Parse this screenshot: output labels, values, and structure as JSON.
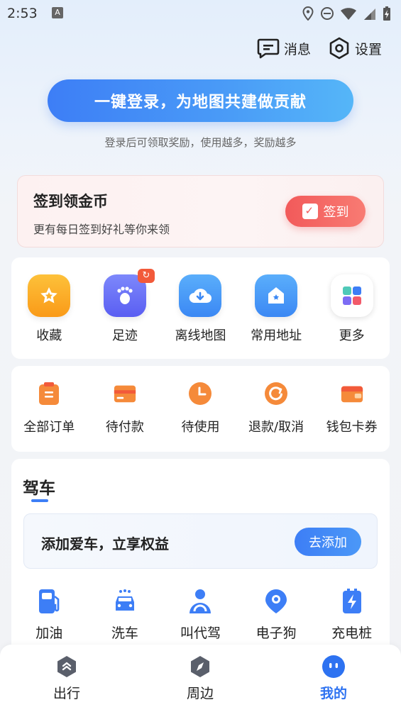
{
  "status_bar": {
    "time": "2:53",
    "a_badge": "A"
  },
  "top_actions": {
    "messages_label": "消息",
    "settings_label": "设置"
  },
  "login": {
    "button_label": "一键登录，为地图共建做贡献",
    "subtitle": "登录后可领取奖励，使用越多，奖励越多"
  },
  "sign_in": {
    "title": "签到领金币",
    "subtitle": "更有每日签到好礼等你来领",
    "button_label": "签到"
  },
  "quick_tools": [
    {
      "label": "收藏",
      "icon": "star-icon"
    },
    {
      "label": "足迹",
      "icon": "footprint-icon"
    },
    {
      "label": "离线地图",
      "icon": "cloud-download-icon"
    },
    {
      "label": "常用地址",
      "icon": "home-pin-icon"
    },
    {
      "label": "更多",
      "icon": "grid-icon"
    }
  ],
  "orders": [
    {
      "label": "全部订单",
      "icon": "order-icon"
    },
    {
      "label": "待付款",
      "icon": "wallet-card-icon"
    },
    {
      "label": "待使用",
      "icon": "clock-icon"
    },
    {
      "label": "退款/取消",
      "icon": "refund-icon"
    },
    {
      "label": "钱包卡券",
      "icon": "coupon-icon"
    }
  ],
  "driving": {
    "title": "驾车",
    "car_prompt": "添加爱车，立享权益",
    "add_button": "去添加",
    "services": [
      {
        "label": "加油",
        "icon": "fuel-icon"
      },
      {
        "label": "洗车",
        "icon": "car-wash-icon"
      },
      {
        "label": "叫代驾",
        "icon": "driver-icon"
      },
      {
        "label": "电子狗",
        "icon": "radar-icon"
      },
      {
        "label": "充电桩",
        "icon": "charging-icon"
      }
    ]
  },
  "bottom_nav": [
    {
      "label": "出行",
      "icon": "travel-icon",
      "active": false
    },
    {
      "label": "周边",
      "icon": "compass-icon",
      "active": false
    },
    {
      "label": "我的",
      "icon": "profile-icon",
      "active": true
    }
  ],
  "colors": {
    "accent": "#3d7ef6",
    "sign_red": "#f25a5a"
  }
}
